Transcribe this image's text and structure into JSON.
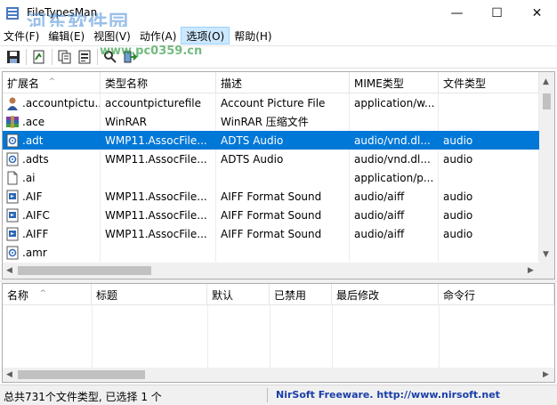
{
  "window": {
    "title": "FileTypesMan",
    "watermark": "河东软件园",
    "watermark_url": "www.pc0359.cn",
    "minimize_glyph": "—",
    "maximize_glyph": "☐",
    "close_glyph": "✕"
  },
  "menu": [
    "文件(F)",
    "编辑(E)",
    "视图(V)",
    "动作(A)",
    "选项(O)",
    "帮助(H)"
  ],
  "active_menu": "选项(O)",
  "toolbar": [
    "save-icon",
    "properties-icon",
    "copy-icon",
    "html-report-icon",
    "find-icon",
    "exit-icon"
  ],
  "file_types": {
    "columns": [
      "扩展名",
      "类型名称",
      "描述",
      "MIME类型",
      "文件类型"
    ],
    "sort_indicator": "^",
    "rows": [
      {
        "icon": "user-picture-icon",
        "ext": ".accountpictu...",
        "type_name": "accountpicturefile",
        "description": "Account Picture File",
        "mime": "application/w...",
        "file_type": ""
      },
      {
        "icon": "winrar-icon",
        "ext": ".ace",
        "type_name": "WinRAR",
        "description": "WinRAR 压缩文件",
        "mime": "",
        "file_type": ""
      },
      {
        "icon": "audio-file-icon",
        "ext": ".adt",
        "type_name": "WMP11.AssocFile...",
        "description": "ADTS Audio",
        "mime": "audio/vnd.dl...",
        "file_type": "audio"
      },
      {
        "icon": "audio-file-icon",
        "ext": ".adts",
        "type_name": "WMP11.AssocFile...",
        "description": "ADTS Audio",
        "mime": "audio/vnd.dl...",
        "file_type": "audio"
      },
      {
        "icon": "blank-file-icon",
        "ext": ".ai",
        "type_name": "",
        "description": "",
        "mime": "application/p...",
        "file_type": ""
      },
      {
        "icon": "media-file-icon",
        "ext": ".AIF",
        "type_name": "WMP11.AssocFile...",
        "description": "AIFF Format Sound",
        "mime": "audio/aiff",
        "file_type": "audio"
      },
      {
        "icon": "media-file-icon",
        "ext": ".AIFC",
        "type_name": "WMP11.AssocFile...",
        "description": "AIFF Format Sound",
        "mime": "audio/aiff",
        "file_type": "audio"
      },
      {
        "icon": "media-file-icon",
        "ext": ".AIFF",
        "type_name": "WMP11.AssocFile...",
        "description": "AIFF Format Sound",
        "mime": "audio/aiff",
        "file_type": "audio"
      },
      {
        "icon": "audio-file-icon",
        "ext": ".amr",
        "type_name": "",
        "description": "",
        "mime": "",
        "file_type": ""
      }
    ],
    "selected_row": 2
  },
  "actions": {
    "columns": [
      "名称",
      "标题",
      "默认",
      "已禁用",
      "最后修改",
      "命令行"
    ],
    "sort_indicator": "^"
  },
  "status": {
    "summary": "总共731个文件类型, 已选择 1 个",
    "credit": "NirSoft Freeware.  http://www.nirsoft.net"
  },
  "colors": {
    "selection": "#0078d7",
    "active_menu": "#cce8ff",
    "credit_link": "#1a3fa8"
  }
}
